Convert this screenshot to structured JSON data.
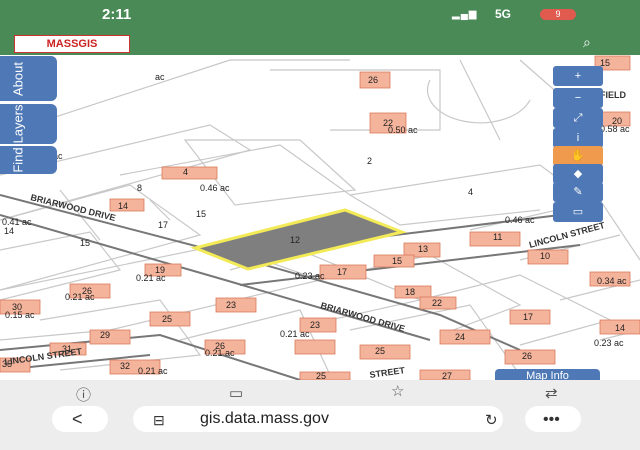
{
  "status": {
    "time": "2:11",
    "network": "5G",
    "battery": "9"
  },
  "app": {
    "logo_text": "MASSGIS"
  },
  "sidebar": {
    "tabs": [
      {
        "label": "About"
      },
      {
        "label": "Layers"
      },
      {
        "label": "Find"
      }
    ]
  },
  "map": {
    "parcel_labels": [
      "26",
      "22",
      "0.50 ac",
      "20",
      "0.58 ac",
      "15",
      "2",
      "4",
      "0.46 ac",
      "8",
      "14",
      "17",
      "15",
      "12",
      "13",
      "11",
      "10",
      "15",
      "17",
      "0.23 ac",
      "0.46 ac",
      "19",
      "0.21 ac",
      "26",
      "0.21 ac",
      "23",
      "25",
      "18",
      "22",
      "17",
      "24",
      "0.34 ac",
      "14",
      "30",
      "0.15 ac",
      "29",
      "31",
      "23",
      "0.21 ac",
      "26",
      "0.21 ac",
      "25",
      "32",
      "0.21 ac",
      "25",
      "27",
      "26",
      "0.23 ac",
      "35",
      "0.41 ac",
      "14",
      "15",
      "4",
      "ac",
      "0.5 ac"
    ],
    "street_labels": [
      "BRIARWOOD DRIVE",
      "BRIARWOOD DRIVE",
      "LINCOLN STREET",
      "LINCOLN STREET",
      "STREET",
      "FIELD"
    ],
    "map_info_label": "Map Info"
  },
  "tools": {
    "items": [
      {
        "name": "zoom-in-icon",
        "glyph": "+"
      },
      {
        "name": "zoom-out-icon",
        "glyph": "−"
      },
      {
        "name": "full-extent-icon",
        "glyph": "⤢"
      },
      {
        "name": "info-icon",
        "glyph": "i"
      },
      {
        "name": "pan-hand-icon",
        "glyph": "✋"
      },
      {
        "name": "measure-icon",
        "glyph": "◆"
      },
      {
        "name": "eraser-icon",
        "glyph": "✎"
      },
      {
        "name": "print-icon",
        "glyph": "▭"
      }
    ]
  },
  "browser": {
    "url": "gis.data.mass.gov"
  },
  "colors": {
    "header": "#4a8a57",
    "building": "#f4b39b",
    "selection": "#f5e84c",
    "tool": "#4f79b6",
    "tool_active": "#ef9a4c"
  }
}
